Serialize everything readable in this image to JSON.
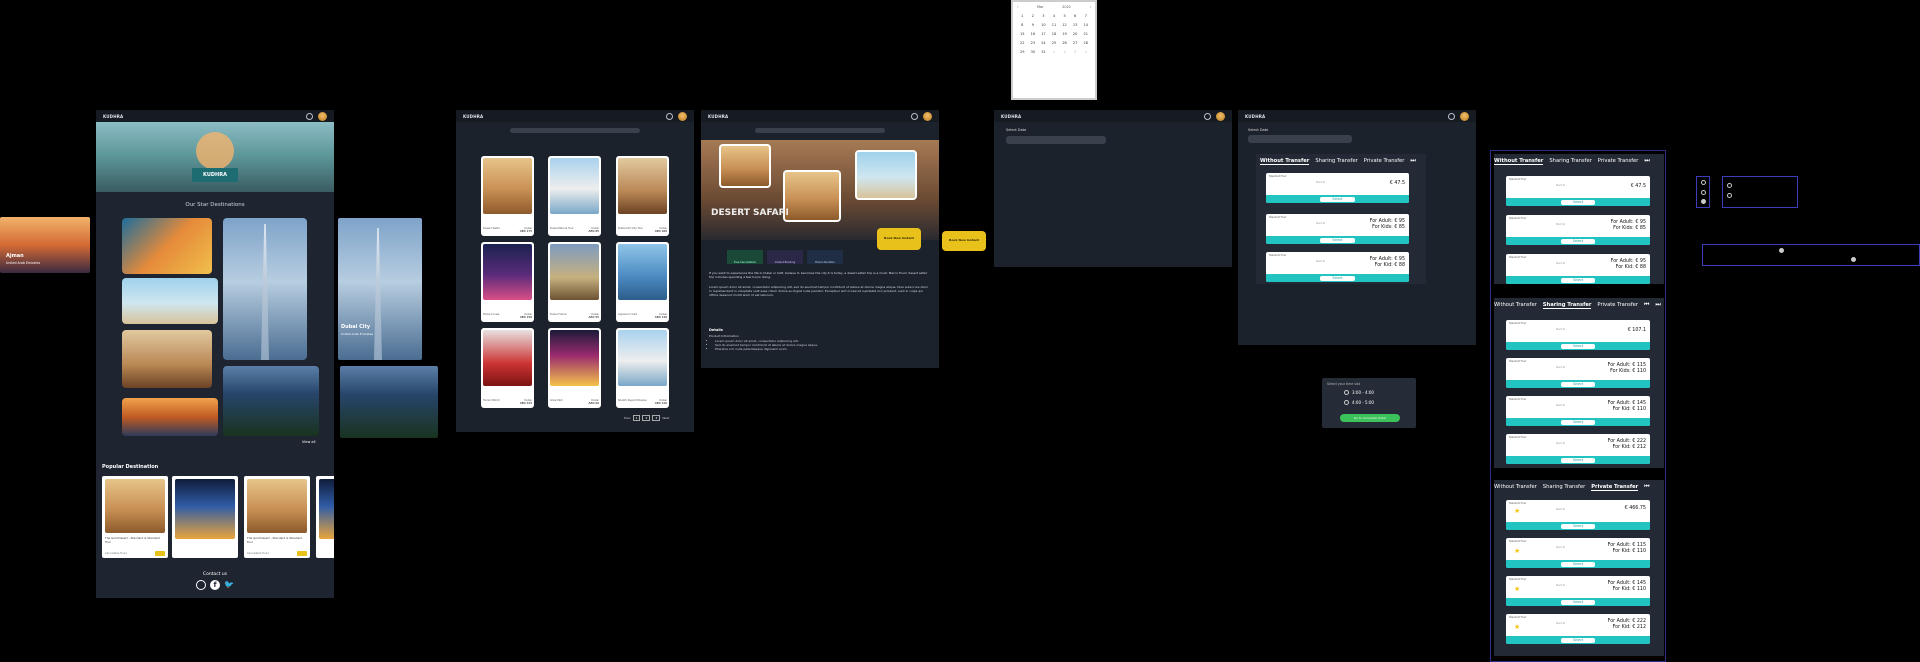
{
  "brand": "KUDHRA",
  "home": {
    "hero_logo": "KUDHRA",
    "section_title": "Our Star Destinations",
    "side_left": {
      "city": "Ajman",
      "country": "United Arab Emirates"
    },
    "side_right": {
      "city": "Dubai City",
      "country": "United Arab Emirates"
    },
    "view_all": "View all",
    "popular_title": "Popular Destination",
    "popular_cards": [
      {
        "title": "The Gold Desert - Standard is Standard Tour",
        "price": "Cancelable Tours"
      },
      {
        "title": "",
        "price": ""
      },
      {
        "title": "The Gold Desert - Standard is Standard Tour",
        "price": "Cancelable Tours"
      }
    ],
    "contact": "Contact us"
  },
  "tours": {
    "cards": [
      {
        "name": "Desert Safari",
        "price": "AED 175",
        "loc": "Dubai"
      },
      {
        "name": "Dubai Marina Tour",
        "price": "AED 85",
        "loc": "Dubai"
      },
      {
        "name": "Dubai Old City Tour",
        "price": "AED 100",
        "loc": "Dubai"
      },
      {
        "name": "Dhow Cruise",
        "price": "AED 150",
        "loc": "Dubai"
      },
      {
        "name": "Dubai Frame",
        "price": "AED 55",
        "loc": "Dubai"
      },
      {
        "name": "Aquarium Visit",
        "price": "AED 140",
        "loc": "Dubai"
      },
      {
        "name": "Ferrari World",
        "price": "AED 345",
        "loc": "Dubai"
      },
      {
        "name": "Glow Park",
        "price": "AED 60",
        "loc": "Dubai"
      },
      {
        "name": "Sheikh Zayed Mosque",
        "price": "AED 120",
        "loc": "Dubai"
      }
    ],
    "pages": [
      "1",
      "2",
      "3"
    ],
    "prev": "Prev",
    "next": "Next"
  },
  "detail": {
    "title": "DESERT SAFARI",
    "book_now": "Book Now Instant",
    "book_now_outside": "Book Now Instant",
    "badges": [
      "Free Cancellation",
      "Instant Booking",
      "Hours Duration"
    ],
    "intro": "If you want to experience the life in Dubai or UAE, believe it, becomes the city it is today, a desert safari trip is a must. Marco Tours' desert safari trip includes spending a few hours doing.",
    "body": "Lorem ipsum dolor sit amet, consectetur adipiscing elit, sed do eiusmod tempor incididunt ut labore et dolore magna aliqua. Duis aute irure dolor in reprehenderit in voluptate velit esse cillum dolore eu fugiat nulla pariatur. Excepteur sint occaecat cupidatat non proident, sunt in culpa qui officia deserunt mollit anim id est laborum.",
    "details_title": "Details",
    "product_info": "Product Information",
    "bullets": [
      "Lorem ipsum dolor sit amet, consectetur adipiscing elit.",
      "Sed do eiusmod tempor incididunt ut labore et dolore magna aliqua.",
      "Pharetra orci nulla pellentesque dignissim enim."
    ]
  },
  "select_date": {
    "label": "Select Date",
    "placeholder": "Select date"
  },
  "calendar": {
    "month": "Mar",
    "year": "2021",
    "days": [
      "1",
      "2",
      "3",
      "4",
      "5",
      "6",
      "7",
      "8",
      "9",
      "10",
      "11",
      "12",
      "13",
      "14",
      "15",
      "16",
      "17",
      "18",
      "19",
      "20",
      "21",
      "22",
      "23",
      "24",
      "25",
      "26",
      "27",
      "28",
      "29",
      "30",
      "31",
      "1",
      "2",
      "3",
      "4"
    ]
  },
  "booking": {
    "label": "Select Date",
    "tabs": [
      "Without Transfer",
      "Sharing Transfer",
      "Private Transfer"
    ],
    "select": "Select",
    "start": "Start at",
    "options_short": [
      {
        "label": "Standard Tour",
        "price": "€  47.5"
      },
      {
        "label": "Standard Tour",
        "price_adult": "For Adult:  €  95",
        "price_kid": "For Kids:  €  85"
      },
      {
        "label": "Standard Tour",
        "price_adult": "For Adult:  €  95",
        "price_kid": "For Kid:  €  88"
      }
    ]
  },
  "time_slot": {
    "title": "Select your time slot",
    "slots": [
      "3:00 - 4:00",
      "4:00 - 5:00"
    ],
    "button": "Go to complete Order"
  },
  "right_panel": {
    "tabs": [
      "Without Transfer",
      "Sharing Transfer",
      "Private Transfer"
    ],
    "group1": [
      {
        "price": "€  47.5"
      },
      {
        "adult": "For Adult:  €  95",
        "kid": "For Kids:  €  85"
      },
      {
        "adult": "For Adult:  €  95",
        "kid": "For Kid:  €  88"
      }
    ],
    "group2": [
      {
        "price": "€  107.1"
      },
      {
        "adult": "For Adult:  €  115",
        "kid": "For Kids:  €  110"
      },
      {
        "adult": "For Adult:  €  145",
        "kid": "For Kid:  €  110"
      },
      {
        "adult": "For Adult:  €  222",
        "kid": "For Kid:  €  212"
      }
    ],
    "group3": [
      {
        "price": "€  466.75"
      },
      {
        "adult": "For Adult:  €  115",
        "kid": "For Kid:  €  110"
      },
      {
        "adult": "For Adult:  €  145",
        "kid": "For Kid:  €  110"
      },
      {
        "adult": "For Adult:  €  222",
        "kid": "For Kid:  €  212"
      }
    ],
    "select": "Select"
  }
}
